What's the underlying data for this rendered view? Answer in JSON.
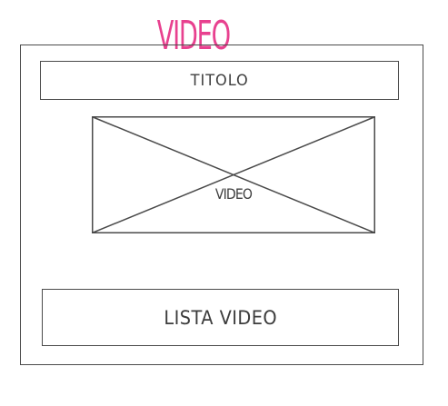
{
  "page": {
    "title": "VIDEO",
    "accent_color": "#e8418f",
    "line_color": "#4a4a4a"
  },
  "header": {
    "title_label": "TITOLO"
  },
  "main": {
    "video_placeholder_label": "VIDEO",
    "list_label": "LISTA VIDEO"
  }
}
